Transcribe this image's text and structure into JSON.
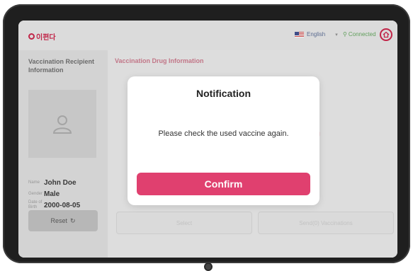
{
  "header": {
    "logo_text": "이편다",
    "language": "English",
    "connection_status": "Connected"
  },
  "recipient": {
    "title": "Vaccination Recipient Information",
    "name_label": "Name",
    "name_value": "John Doe",
    "gender_label": "Gender",
    "gender_value": "Male",
    "dob_label": "Date of Birth",
    "dob_value": "2000-08-05",
    "reset_label": "Reset"
  },
  "main": {
    "title": "Vaccination Drug Information",
    "select_label": "Select",
    "send_label": "Send(0) Vaccinations"
  },
  "modal": {
    "title": "Notification",
    "message": "Please check the used vaccine again.",
    "confirm_label": "Confirm"
  },
  "colors": {
    "accent": "#e0406f",
    "brand": "#c81f45",
    "connected": "#5fa35a"
  },
  "icons": {
    "home": "home-icon",
    "reset": "refresh-icon",
    "avatar": "user-icon",
    "connected": "plug-icon"
  }
}
